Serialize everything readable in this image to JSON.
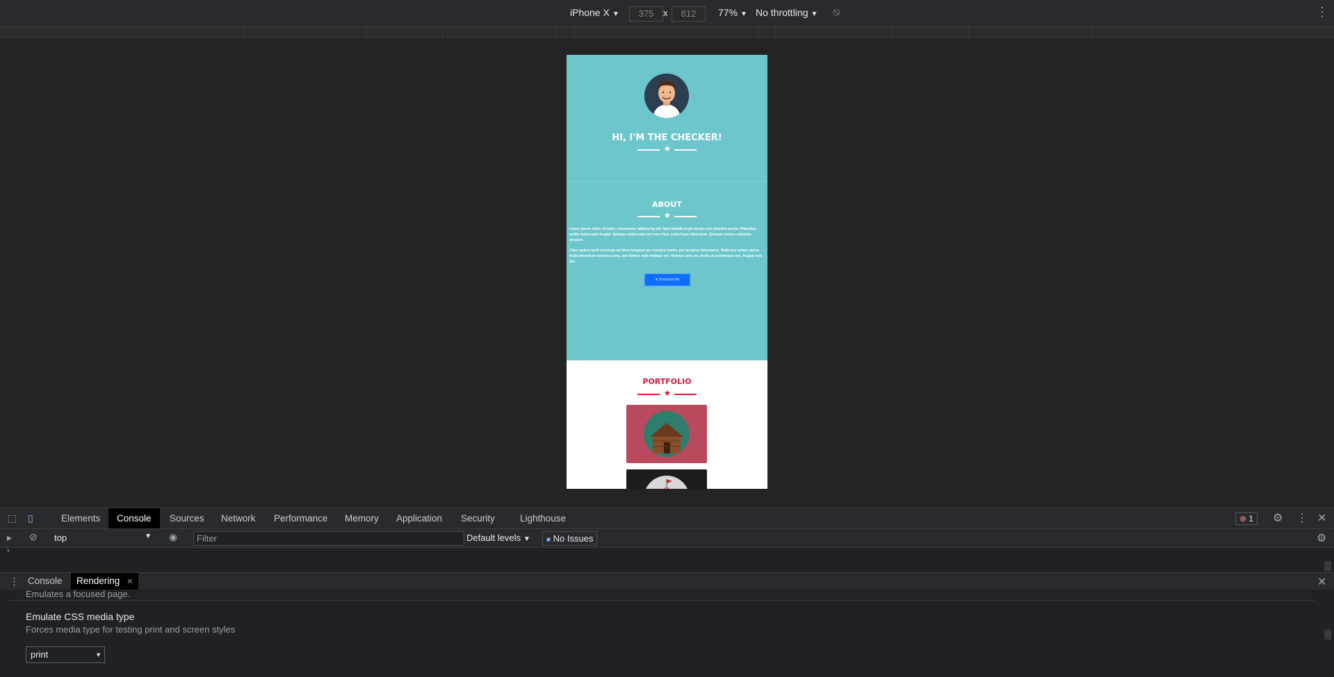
{
  "device_toolbar": {
    "device": "iPhone X",
    "width": "375",
    "height": "812",
    "times": "x",
    "zoom": "77%",
    "throttling": "No throttling"
  },
  "page": {
    "hero_title": "HI, I'M THE CHECKER!",
    "about_title": "ABOUT",
    "about_p1": "Lorem ipsum dolor sit amet, consectetur adipiscing elit. Nam blandit turpis iaculis nisl pharetra auctor. Phasellus mollis malesuada feugiat. Quisque malesuada orci non risus scelerisque bibendum. Quisque viverra vulputate posuere.",
    "about_p2": "Class aptent taciti sociosqu ad litora torquent per conubia nostra, per inceptos himenaeos. Nulla non ornare purus. Nulla bibendum maximus urna, sed finibus velit tristique vel. Vivamus ante mi, mollis at scelerisque nec, feugiat non dui.",
    "download_label": "Download file",
    "portfolio_title": "PORTFOLIO"
  },
  "devtools": {
    "tabs": [
      "Elements",
      "Console",
      "Sources",
      "Network",
      "Performance",
      "Memory",
      "Application",
      "Security",
      "Lighthouse"
    ],
    "active_tab": "Console",
    "error_count": "1",
    "context": "top",
    "filter_placeholder": "Filter",
    "levels": "Default levels",
    "issues": "No Issues",
    "drawer_tabs": [
      "Console",
      "Rendering"
    ],
    "drawer_active": "Rendering",
    "rendering": {
      "prev_desc": "Emulates a focused page.",
      "media_title": "Emulate CSS media type",
      "media_desc": "Forces media type for testing print and screen styles",
      "media_value": "print"
    }
  },
  "colors": {
    "hero_bg": "#6cc6cb",
    "accent_red": "#d6163f",
    "button_blue": "#0d6efd"
  }
}
